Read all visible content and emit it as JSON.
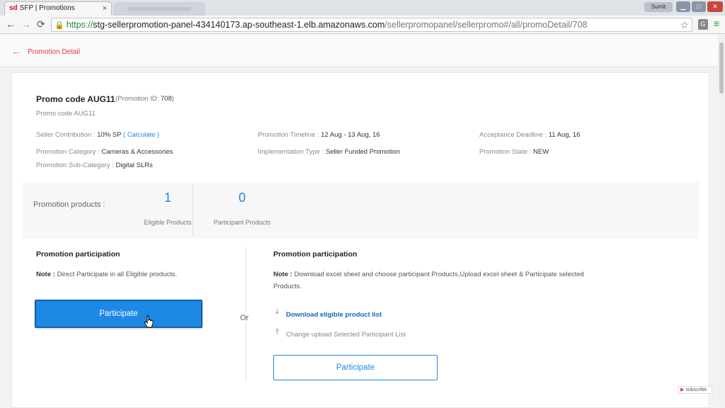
{
  "browser": {
    "tab_title": "SFP | Promotions",
    "tab_favicon": "sd",
    "tab_close": "×",
    "user_badge": "Sumit",
    "url_scheme": "https://",
    "url_host": "stg-sellerpromotion-panel-434140173.ap-southeast-1.elb.amazonaws.com",
    "url_path": "/sellerpromopanel/sellerpromo#/all/promoDetail/708",
    "ext_label": "G"
  },
  "header": {
    "back": "←",
    "title": "Promotion Detail"
  },
  "promo": {
    "title": "Promo code AUG11",
    "id_prefix": "(Promotion ID: ",
    "id_value": "708",
    "id_suffix": ")",
    "subtitle": "Promo code AUG11",
    "seller_contribution_label": "Seller Contribution : ",
    "seller_contribution_value": "10% SP",
    "calculate_open": " ( ",
    "calculate_link": "Calculate",
    "calculate_close": " )",
    "timeline_label": "Promotion Timeline : ",
    "timeline_value": "12 Aug - 13 Aug, 16",
    "deadline_label": "Acceptance Deadline : ",
    "deadline_value": "11 Aug, 16",
    "category_label": "Promotion Category : ",
    "category_value": "Cameras & Accessories",
    "impl_label": "Implementation Type : ",
    "impl_value": "Seller Funded Promotion",
    "state_label": "Promotion State : ",
    "state_value": "NEW",
    "subcategory_label": "Promotion Sub-Category : ",
    "subcategory_value": "Digital SLRs"
  },
  "stats": {
    "label": "Promotion products :",
    "eligible_count": "1",
    "eligible_label": "Eligible Products",
    "participant_count": "0",
    "participant_label": "Participant Products"
  },
  "left_section": {
    "title": "Promotion participation",
    "note_label": "Note : ",
    "note_text": "Direct Participate in all Eligible products.",
    "button": "Participate"
  },
  "or_text": "Or",
  "right_section": {
    "title": "Promotion participation",
    "note_label": "Note : ",
    "note_text": "Download excel sheet and choose participant Products,Upload excel sheet & Participate selected Products.",
    "download_link": "Download eligible product list",
    "upload_link": "Change upload Selected Participant List",
    "button": "Participate"
  },
  "badge": {
    "text": "subscribe"
  },
  "colors": {
    "accent": "#1e88e5",
    "title_red": "#e53935"
  },
  "icons": [
    "back-arrow-icon",
    "reload-icon",
    "lock-icon",
    "star-icon",
    "menu-icon",
    "download-icon",
    "upload-icon",
    "cursor-icon"
  ]
}
